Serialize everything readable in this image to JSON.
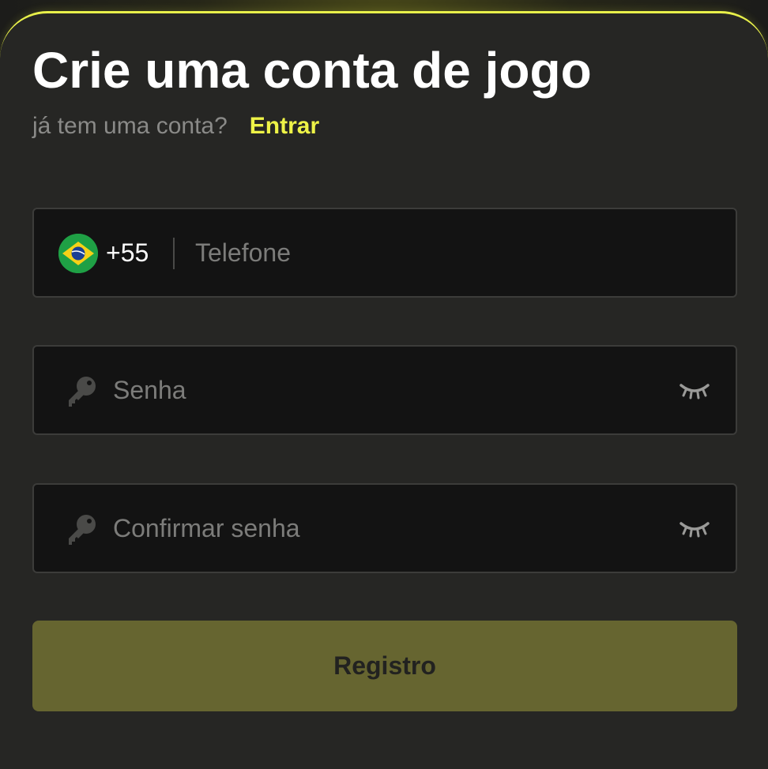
{
  "form": {
    "title": "Crie uma conta de jogo",
    "subtitle": "já tem uma conta?",
    "login_link": "Entrar",
    "phone": {
      "country_flag": "brazil-flag",
      "dial_code": "+55",
      "placeholder": "Telefone",
      "value": ""
    },
    "password": {
      "icon": "key-icon",
      "placeholder": "Senha",
      "value": "",
      "toggle_icon": "eye-closed-icon"
    },
    "confirm_password": {
      "icon": "key-icon",
      "placeholder": "Confirmar senha",
      "value": "",
      "toggle_icon": "eye-closed-icon"
    },
    "submit_label": "Registro"
  },
  "colors": {
    "accent": "#eef347",
    "card_bg": "#262624",
    "field_bg": "#131313",
    "button_bg": "#666530"
  }
}
